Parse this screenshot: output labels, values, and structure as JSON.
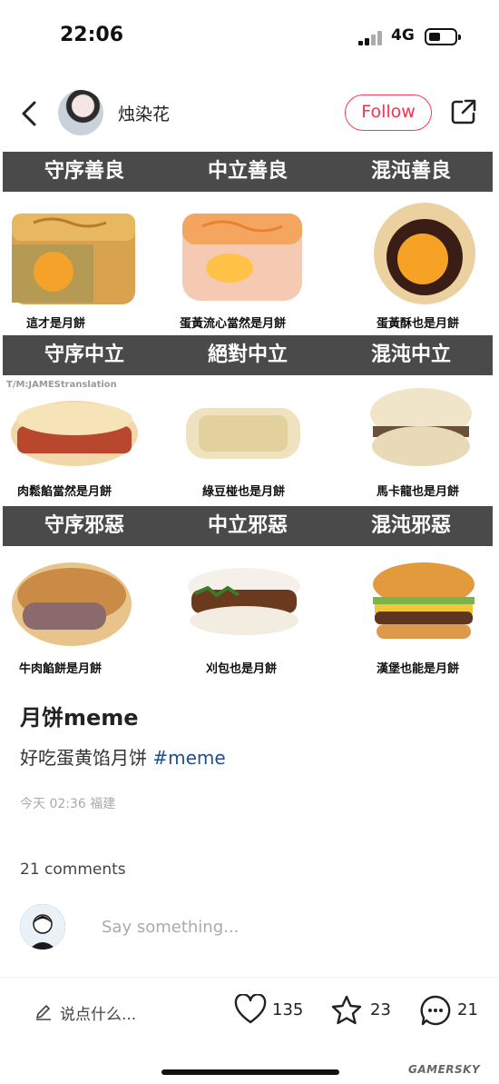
{
  "status_bar": {
    "time": "22:06",
    "network": "4G"
  },
  "top_bar": {
    "username": "烛染花",
    "follow_label": "Follow"
  },
  "meme": {
    "rows": [
      {
        "headers": [
          "守序善良",
          "中立善良",
          "混沌善良"
        ],
        "captions": [
          "這才是月餅",
          "蛋黃流心當然是月餅",
          "蛋黃酥也是月餅"
        ]
      },
      {
        "headers": [
          "守序中立",
          "絕對中立",
          "混沌中立"
        ],
        "captions": [
          "肉鬆餡當然是月餅",
          "綠豆椪也是月餅",
          "馬卡龍也是月餅"
        ]
      },
      {
        "headers": [
          "守序邪惡",
          "中立邪惡",
          "混沌邪惡"
        ],
        "captions": [
          "牛肉餡餅是月餅",
          "刈包也是月餅",
          "漢堡也能是月餅"
        ]
      }
    ],
    "watermark": "T/M:JAMEStranslation"
  },
  "post": {
    "title": "月饼meme",
    "body": "好吃蛋黄馅月饼 ",
    "hashtag": "#meme",
    "meta": "今天 02:36 福建"
  },
  "comments": {
    "count_label": "21 comments",
    "input_placeholder": "Say something..."
  },
  "bottom_bar": {
    "write_label": "说点什么...",
    "likes": "135",
    "stars": "23",
    "comments": "21"
  },
  "corner_watermark": "GAMERSKY",
  "colors": {
    "accent": "#ff2e4d",
    "band": "#4a4a4a",
    "hashtag": "#1d4f91"
  }
}
